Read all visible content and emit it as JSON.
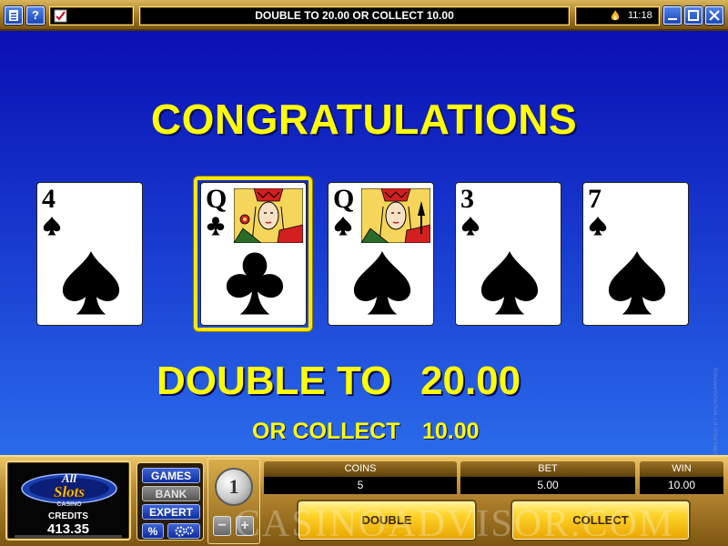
{
  "toolbar": {
    "status_message": "DOUBLE TO 20.00 OR COLLECT 10.00",
    "clock": "11:18",
    "help_label": "?"
  },
  "game": {
    "congrats_text": "CONGRATULATIONS",
    "double_label": "DOUBLE TO",
    "double_amount": "20.00",
    "collect_label": "OR COLLECT",
    "collect_amount": "10.00",
    "powered_by": "POWERED BY MICROGAMING™",
    "cards": [
      {
        "rank": "4",
        "suit": "spades",
        "held": false
      },
      {
        "rank": "Q",
        "suit": "clubs",
        "held": true
      },
      {
        "rank": "Q",
        "suit": "spades",
        "held": false
      },
      {
        "rank": "3",
        "suit": "spades",
        "held": false
      },
      {
        "rank": "7",
        "suit": "spades",
        "held": false
      }
    ]
  },
  "brand": {
    "logo_line1": "All",
    "logo_line2": "Slots",
    "logo_line3": "CASINO",
    "credits_label": "CREDITS",
    "credits_value": "413.35"
  },
  "modes": {
    "games": "GAMES",
    "bank": "BANK",
    "expert": "EXPERT",
    "percent": "%"
  },
  "coin": {
    "value": "1",
    "minus": "−",
    "plus": "+"
  },
  "meters": {
    "coins_label": "COINS",
    "coins_value": "5",
    "bet_label": "BET",
    "bet_value": "5.00",
    "win_label": "WIN",
    "win_value": "10.00"
  },
  "actions": {
    "double": "DOUBLE",
    "collect": "COLLECT"
  },
  "watermark": "CASINOADVISOR.COM",
  "colors": {
    "highlight_yellow": "#ffff00",
    "field_blue": "#1636cc",
    "gold_panel": "#b58630"
  }
}
